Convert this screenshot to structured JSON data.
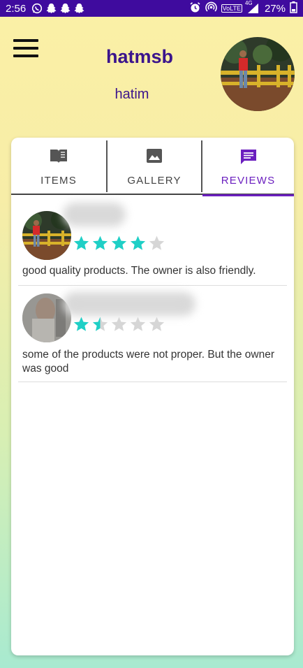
{
  "status_bar": {
    "time": "2:56",
    "battery": "27%",
    "network_badge": "VoLTE",
    "signal_badge": "4G"
  },
  "profile": {
    "username": "hatmsb",
    "full_name": "hatim"
  },
  "tabs": [
    {
      "label": "ITEMS",
      "icon": "book-icon",
      "active": false
    },
    {
      "label": "GALLERY",
      "icon": "image-icon",
      "active": false
    },
    {
      "label": "REVIEWS",
      "icon": "message-icon",
      "active": true
    }
  ],
  "reviews": [
    {
      "rating": 4,
      "text": "good quality products. The owner is also friendly."
    },
    {
      "rating": 1.5,
      "text": "some of the products were not proper. But the owner was good"
    }
  ],
  "colors": {
    "status_bar": "#3f0b9e",
    "accent": "#6b1fbf",
    "title": "#3b148c",
    "star_filled": "#1fcfc6",
    "star_empty": "#d6d6d6"
  }
}
